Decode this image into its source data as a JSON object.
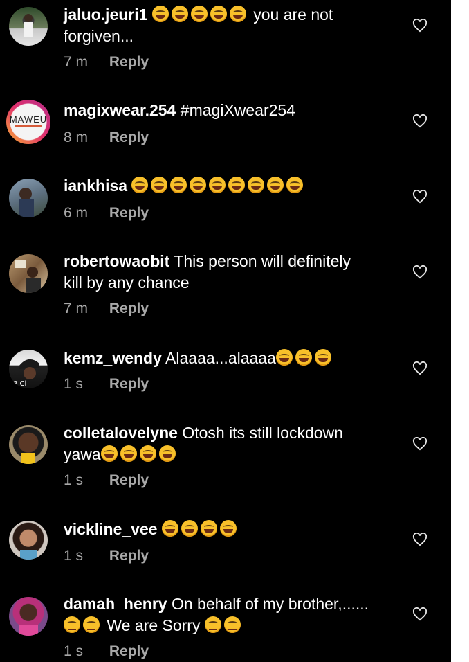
{
  "comments": [
    {
      "username": "jaluo.jeuri1",
      "line1": "you are not",
      "line2": "forgiven...",
      "time": "7 m",
      "reply": "Reply",
      "avatar": "avatar-man-standing"
    },
    {
      "username": "magixwear.254",
      "line1": "#magiXwear254",
      "time": "8 m",
      "reply": "Reply",
      "avatar": "avatar-brand-logo",
      "brand": "MAWEU"
    },
    {
      "username": "iankhisa",
      "line1": "",
      "time": "6 m",
      "reply": "Reply",
      "avatar": "avatar-person"
    },
    {
      "username": "robertowaobit",
      "line1": "This person will definitely",
      "line2": "kill by any chance",
      "time": "7 m",
      "reply": "Reply",
      "avatar": "avatar-person-room"
    },
    {
      "username": "kemz_wendy",
      "line1": "Alaaaa...alaaaa",
      "time": "1 s",
      "reply": "Reply",
      "avatar": "avatar-person-cap"
    },
    {
      "username": "colletalovelyne",
      "line1": "Otosh  its still lockdown",
      "line2": "yawa",
      "time": "1 s",
      "reply": "Reply",
      "avatar": "avatar-woman"
    },
    {
      "username": "vickline_vee",
      "line1": "",
      "time": "1 s",
      "reply": "Reply",
      "avatar": "avatar-woman-selfie"
    },
    {
      "username": "damah_henry",
      "line1": "On behalf of my brother,......",
      "line2": "We are Sorry",
      "time": "1 s",
      "reply": "Reply",
      "avatar": "avatar-woman-pink"
    }
  ],
  "colors": {
    "background": "#000000",
    "text": "#ffffff",
    "meta": "#a8a8a8",
    "emoji": "#f8c02a"
  }
}
